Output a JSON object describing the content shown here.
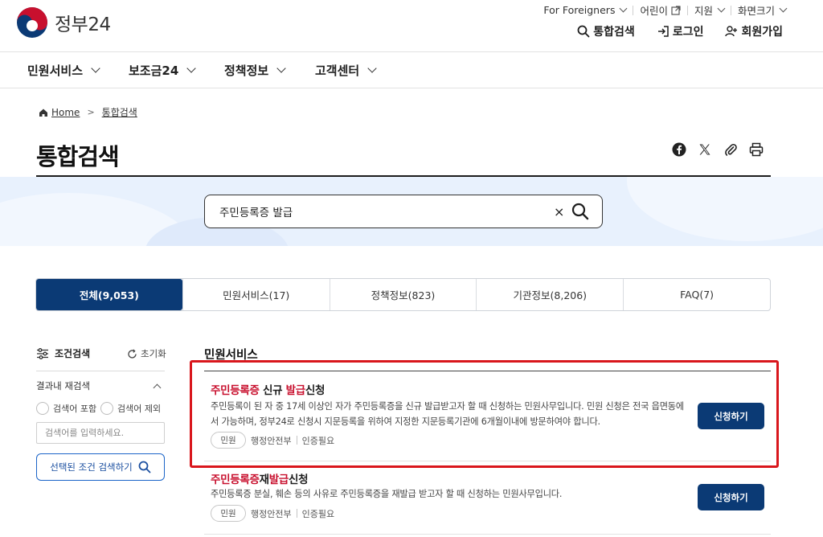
{
  "header": {
    "logo_text": "정부24",
    "util": {
      "foreigners": "For Foreigners",
      "kids": "어린이",
      "support": "지원",
      "screen_size": "화면크기"
    },
    "actions": {
      "search": "통합검색",
      "login": "로그인",
      "signup": "회원가입"
    }
  },
  "gnb": {
    "items": [
      "민원서비스",
      "보조금24",
      "정책정보",
      "고객센터"
    ]
  },
  "breadcrumb": {
    "home": "Home",
    "current": "통합검색"
  },
  "page": {
    "title": "통합검색"
  },
  "search": {
    "value": "주민등록증 발급",
    "clear": "×"
  },
  "tabs": [
    {
      "label": "전체(9,053)",
      "active": true
    },
    {
      "label": "민원서비스(17)",
      "active": false
    },
    {
      "label": "정책정보(823)",
      "active": false
    },
    {
      "label": "기관정보(8,206)",
      "active": false
    },
    {
      "label": "FAQ(7)",
      "active": false
    }
  ],
  "filter": {
    "title": "조건검색",
    "reset": "초기화",
    "refine_title": "결과내 재검색",
    "include_label": "검색어 포함",
    "exclude_label": "검색어 제외",
    "input_placeholder": "검색어를 입력하세요.",
    "submit_label": "선택된 조건 검색하기"
  },
  "results": {
    "section_title": "민원서비스",
    "items": [
      {
        "title_parts": [
          "주민등록증",
          " 신규 ",
          "발급",
          "신청"
        ],
        "description": "주민등록이 된 자 중 17세 이상인 자가 주민등록증을 신규 발급받고자 할 때 신청하는 민원사무입니다. 민원 신청은 전국 읍면동에서 가능하며, 정부24로 신청시 지문등록을 위하여 지정한 지문등록기관에 6개월이내에 방문하여야 합니다.",
        "tag": "민원",
        "agency": "행정안전부",
        "auth": "인증필요",
        "button": "신청하기"
      },
      {
        "title_parts": [
          "주민등록증",
          "재",
          "발급",
          "신청"
        ],
        "description": "주민등록증 분실, 훼손 등의 사유로 주민등록증을 재발급 받고자 할 때 신청하는 민원사무입니다.",
        "tag": "민원",
        "agency": "행정안전부",
        "auth": "인증필요",
        "button": "신청하기"
      }
    ]
  },
  "colors": {
    "primary": "#0b3a75",
    "highlight_text": "#c8102e",
    "annotation_frame": "#d9161c",
    "band": "#e8f1fd"
  }
}
